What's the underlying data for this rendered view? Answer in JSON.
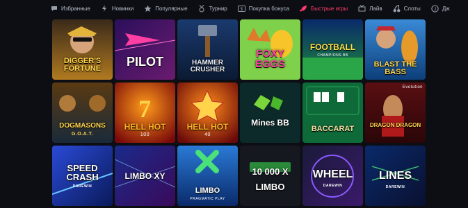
{
  "nav": {
    "items": [
      {
        "label": "Избранные",
        "icon": "chat-bubble-icon",
        "active": false
      },
      {
        "label": "Новинки",
        "icon": "lightning-icon",
        "active": false
      },
      {
        "label": "Популярные",
        "icon": "star-icon",
        "active": false
      },
      {
        "label": "Турнир",
        "icon": "medal-icon",
        "active": false
      },
      {
        "label": "Покупка бонуса",
        "icon": "bonus-icon",
        "active": false
      },
      {
        "label": "Быстрые игры",
        "icon": "rocket-icon",
        "active": true
      },
      {
        "label": "Лайв",
        "icon": "live-icon",
        "active": false
      },
      {
        "label": "Слоты",
        "icon": "cherries-icon",
        "active": false
      },
      {
        "label": "Дж",
        "icon": "jackpot-icon",
        "active": false
      }
    ],
    "accent_color": "#ff3b6b"
  },
  "games": [
    {
      "title": "DIGGER'S FORTUNE",
      "sub": ""
    },
    {
      "title": "PILOT",
      "sub": ""
    },
    {
      "title": "HAMMER CRUSHER",
      "sub": ""
    },
    {
      "title": "FOXY EGGS",
      "sub": ""
    },
    {
      "title": "FOOTBALL",
      "sub": "CHAMPIONS BB"
    },
    {
      "title": "BLAST THE BASS",
      "sub": ""
    },
    {
      "title": "DOGMASONS",
      "sub": "G.O.A.T."
    },
    {
      "title": "HELL HOT",
      "sub": "100"
    },
    {
      "title": "HELL HOT",
      "sub": "40"
    },
    {
      "title": "Mines BB",
      "sub": ""
    },
    {
      "title": "BACCARAT",
      "sub": ""
    },
    {
      "title": "DRAGON DRAGON",
      "sub": "Evolution"
    },
    {
      "title": "SPEED CRASH",
      "sub": "DAREWIN"
    },
    {
      "title": "LIMBO XY",
      "sub": ""
    },
    {
      "title": "LIMBO",
      "sub": "PRAGMATIC PLAY"
    },
    {
      "title": "10 000 X LIMBO",
      "sub": ""
    },
    {
      "title": "WHEEL",
      "sub": "DAREWIN"
    },
    {
      "title": "LINES",
      "sub": "DAREWIN"
    }
  ]
}
